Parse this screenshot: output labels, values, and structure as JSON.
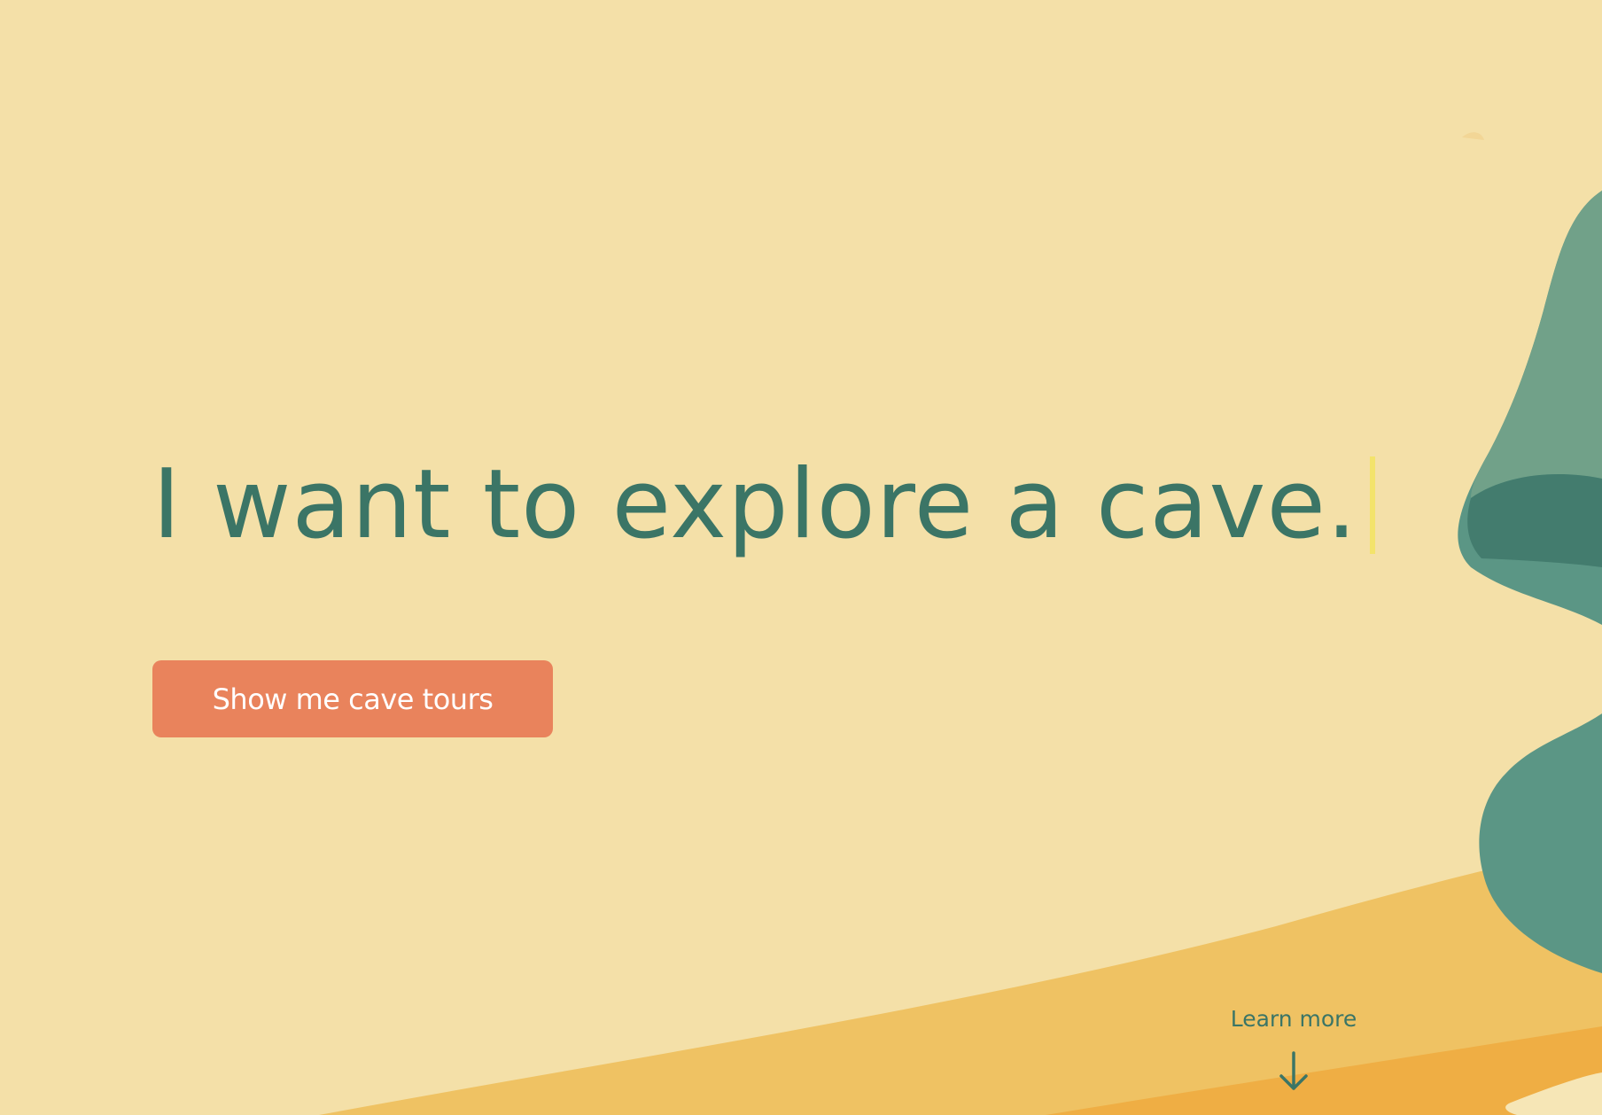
{
  "hero": {
    "headline": "I want to explore a cave.",
    "cta_label": "Show me cave tours",
    "learn_more_label": "Learn more",
    "icons": {
      "scroll": "arrow-down-icon",
      "cursor": "text-cursor"
    }
  },
  "colors": {
    "background": "#f4e0a8",
    "headline_text": "#3b7566",
    "cta_background": "#e9835c",
    "cta_text": "#ffffff",
    "cursor": "#f3e36b",
    "sand": "#efc263",
    "sand_dark": "#efae44",
    "foliage_light": "#71a189",
    "foliage": "#5b9685",
    "foliage_dark": "#437c6e"
  }
}
